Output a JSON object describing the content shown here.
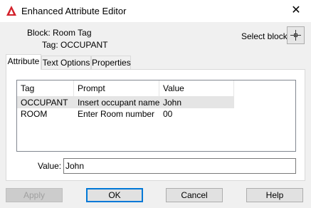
{
  "window": {
    "title": "Enhanced Attribute Editor"
  },
  "info": {
    "block_label": "Block: Room Tag",
    "tag_label": "Tag: OCCUPANT",
    "select_block_label": "Select block"
  },
  "tabs": [
    {
      "label": "Attribute",
      "active": true
    },
    {
      "label": "Text Options",
      "active": false
    },
    {
      "label": "Properties",
      "active": false
    }
  ],
  "table": {
    "columns": [
      "Tag",
      "Prompt",
      "Value"
    ],
    "rows": [
      {
        "tag": "OCCUPANT",
        "prompt": "Insert occupant name",
        "value": "John",
        "selected": true
      },
      {
        "tag": "ROOM",
        "prompt": "Enter Room number",
        "value": "00",
        "selected": false
      }
    ]
  },
  "value_field": {
    "label": "Value:",
    "value": "John"
  },
  "buttons": {
    "apply": "Apply",
    "ok": "OK",
    "cancel": "Cancel",
    "help": "Help"
  },
  "colors": {
    "accent": "#0078d7",
    "logo": "#d3202a"
  }
}
